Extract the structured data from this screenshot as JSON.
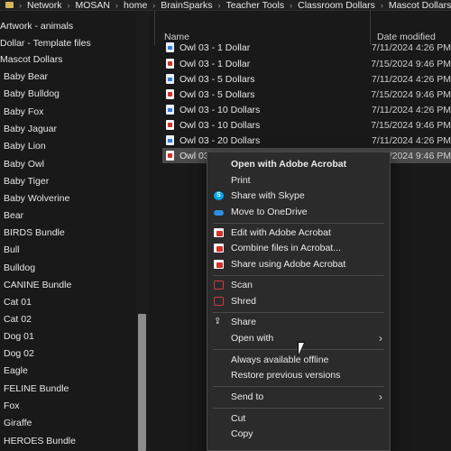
{
  "address_bar": {
    "crumbs": [
      "Network",
      "MOSAN",
      "home",
      "BrainSparks",
      "Teacher Tools",
      "Classroom Dollars",
      "Mascot Dollars"
    ]
  },
  "sidebar": {
    "items": [
      "Artwork - animals",
      "Dollar - Template files",
      "Mascot Dollars",
      "Baby Bear",
      "Baby Bulldog",
      "Baby Fox",
      "Baby Jaguar",
      "Baby Lion",
      "Baby Owl",
      "Baby Tiger",
      "Baby Wolverine",
      "Bear",
      "BIRDS Bundle",
      "Bull",
      "Bulldog",
      "CANINE Bundle",
      "Cat 01",
      "Cat 02",
      "Dog 01",
      "Dog 02",
      "Eagle",
      "FELINE Bundle",
      "Fox",
      "Giraffe",
      "HEROES Bundle"
    ]
  },
  "columns": {
    "name": "Name",
    "date": "Date modified"
  },
  "files": [
    {
      "name": "Owl 03 - 1 Dollar",
      "date": "7/11/2024 4:26 PM",
      "icon": "doc-icon"
    },
    {
      "name": "Owl 03 - 1 Dollar",
      "date": "7/15/2024 9:46 PM",
      "icon": "pdf-icon"
    },
    {
      "name": "Owl 03 - 5 Dollars",
      "date": "7/11/2024 4:26 PM",
      "icon": "doc-icon"
    },
    {
      "name": "Owl 03 - 5 Dollars",
      "date": "7/15/2024 9:46 PM",
      "icon": "pdf-icon"
    },
    {
      "name": "Owl 03 - 10 Dollars",
      "date": "7/11/2024 4:26 PM",
      "icon": "doc-icon"
    },
    {
      "name": "Owl 03 - 10 Dollars",
      "date": "7/15/2024 9:46 PM",
      "icon": "pdf-icon"
    },
    {
      "name": "Owl 03 - 20 Dollars",
      "date": "7/11/2024 4:26 PM",
      "icon": "doc-icon"
    },
    {
      "name": "Owl 03",
      "date": "7/15/2024 9:46 PM",
      "icon": "pdf-icon",
      "selected": true
    }
  ],
  "context_menu": {
    "open_with_acrobat": "Open with Adobe Acrobat",
    "print": "Print",
    "share_skype": "Share with Skype",
    "move_onedrive": "Move to OneDrive",
    "edit_acrobat": "Edit with Adobe Acrobat",
    "combine_acrobat": "Combine files in Acrobat...",
    "share_acrobat": "Share using Adobe Acrobat",
    "scan": "Scan",
    "shred": "Shred",
    "share": "Share",
    "open_with": "Open with",
    "always_available": "Always available offline",
    "restore_versions": "Restore previous versions",
    "send_to": "Send to",
    "cut": "Cut",
    "copy": "Copy"
  },
  "colors": {
    "background": "#191919",
    "menu_background": "#2b2b2b",
    "selection": "#4a4a4a",
    "folder": "#d6b45a",
    "pdf_red": "#d4302b",
    "skype_blue": "#00a8e6",
    "onedrive_blue": "#2e8fe3"
  }
}
